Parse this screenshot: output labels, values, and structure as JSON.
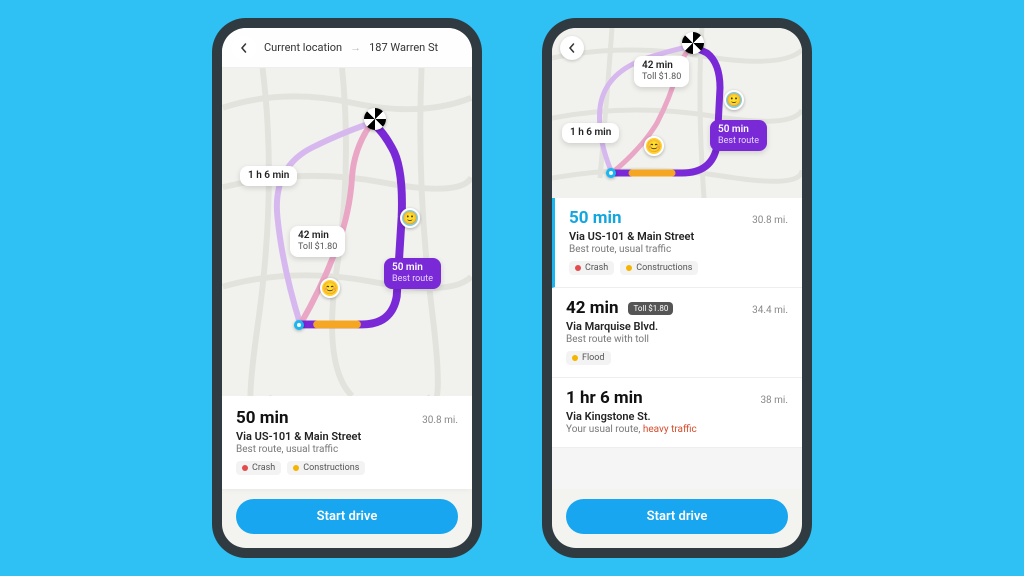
{
  "colors": {
    "accent": "#18a6f0",
    "route_primary": "#7a29d6",
    "heavy_traffic": "#d84c2c"
  },
  "phone1": {
    "topbar": {
      "from": "Current location",
      "to": "187 Warren St"
    },
    "map": {
      "callout_alt1": {
        "time": "1 h 6 min"
      },
      "callout_alt2": {
        "time": "42 min",
        "toll": "Toll $1.80"
      },
      "callout_best": {
        "time": "50 min",
        "label": "Best route"
      }
    },
    "panel": {
      "time": "50 min",
      "distance": "30.8 mi.",
      "via": "Via US-101 & Main Street",
      "desc": "Best route, usual traffic",
      "tags": {
        "crash": "Crash",
        "constructions": "Constructions"
      },
      "start": "Start drive"
    }
  },
  "phone2": {
    "map": {
      "callout_alt1": {
        "time": "1 h 6 min"
      },
      "callout_alt2": {
        "time": "42 min",
        "toll": "Toll $1.80"
      },
      "callout_best": {
        "time": "50 min",
        "label": "Best route"
      }
    },
    "routes": [
      {
        "time": "50 min",
        "distance": "30.8 mi.",
        "via": "Via US-101 & Main Street",
        "desc": "Best route, usual traffic",
        "tags": {
          "crash": "Crash",
          "constructions": "Constructions"
        }
      },
      {
        "time": "42 min",
        "toll": "Toll $1.80",
        "distance": "34.4 mi.",
        "via": "Via Marquise Blvd.",
        "desc": "Best route with toll",
        "tags": {
          "flood": "Flood"
        }
      },
      {
        "time": "1 hr 6 min",
        "distance": "38 mi.",
        "via": "Via Kingstone St.",
        "desc_prefix": "Your usual route, ",
        "desc_heavy": "heavy traffic"
      }
    ],
    "start": "Start drive"
  }
}
